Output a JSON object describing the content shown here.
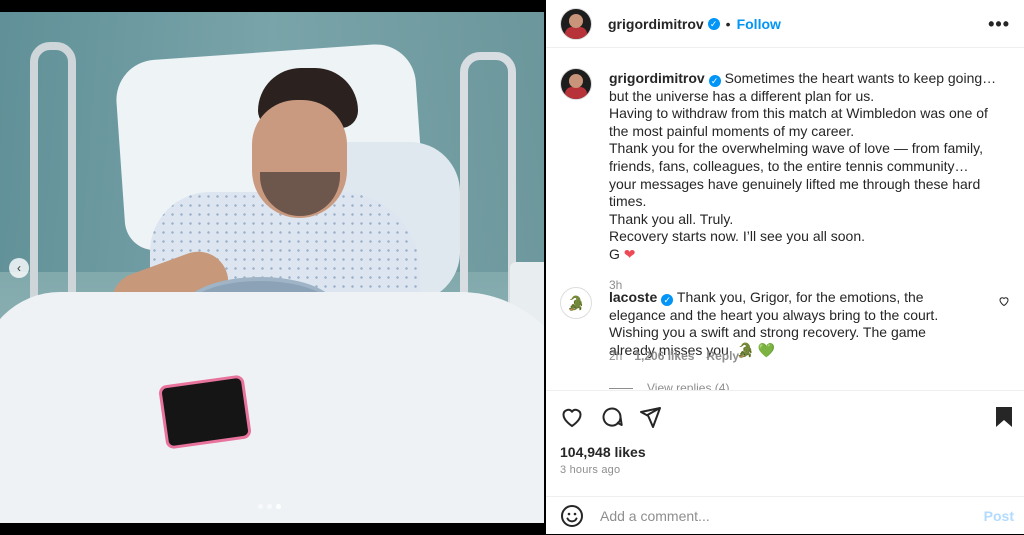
{
  "post": {
    "author": "grigordimitrov",
    "follow_separator": "•",
    "follow_label": "Follow",
    "more_label": "•••",
    "carousel": {
      "slide_count": 3,
      "active_slide": 3
    }
  },
  "caption": {
    "author": "grigordimitrov",
    "lines": [
      "Sometimes the heart wants to keep going… but the universe has a different plan for us.",
      "Having to withdraw from this match at Wimbledon was one of the most painful moments of my career.",
      "Thank you for the overwhelming wave of love — from family, friends, fans, colleagues, to the entire tennis community… your messages have genuinely lifted me through these hard times.",
      "Thank you all. Truly.",
      "Recovery starts now. I’ll see you all soon.",
      "G"
    ],
    "heart_emoji": "❤",
    "time": "3h"
  },
  "comment": {
    "author": "lacoste",
    "text": "Thank you, Grigor, for the emotions, the elegance and the heart you always bring to the court. Wishing you a swift and strong recovery. The game already misses you.",
    "emoji": "🐊 💚",
    "time": "2h",
    "likes": "1,206 likes",
    "reply_label": "Reply",
    "view_replies": "View replies (4)"
  },
  "footer": {
    "likes": "104,948 likes",
    "ago": "3 hours ago",
    "comment_placeholder": "Add a comment...",
    "post_label": "Post"
  }
}
